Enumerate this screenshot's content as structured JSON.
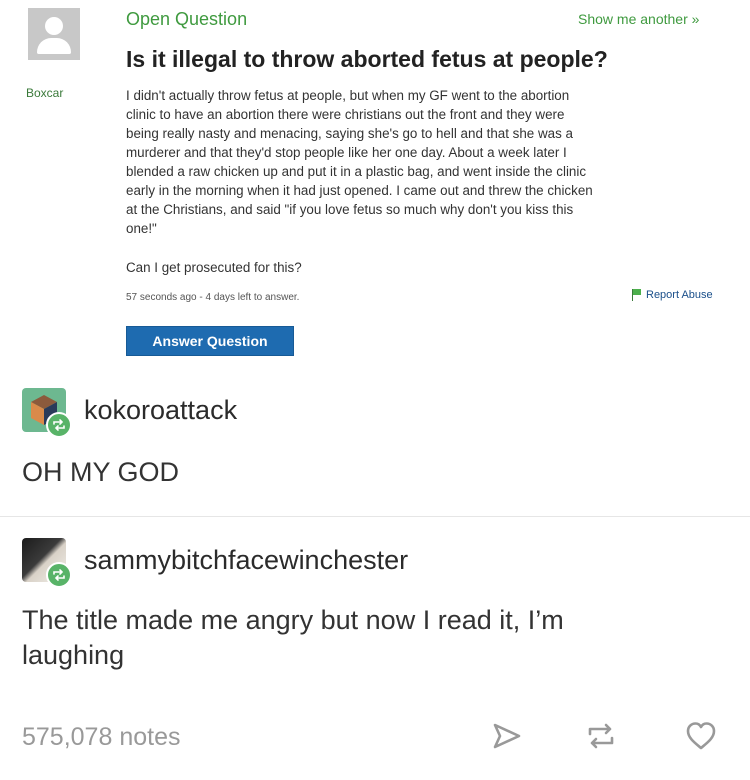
{
  "question": {
    "label": "Open Question",
    "show_another": "Show me another »",
    "asker": "Boxcar",
    "title": "Is it illegal to throw aborted fetus at people?",
    "body_lines": [
      "I didn't actually throw fetus at people, but when my GF went to the abortion",
      "clinic to have an abortion there were christians out the front and they were",
      "being really nasty and menacing, saying she's go to hell and that she was a",
      "murderer and that they'd stop people like her one day. About a week later I",
      "blended a raw chicken up and put it in a plastic bag, and went inside the clinic",
      "early in the morning when it had just opened. I came out and threw the chicken",
      "at the Christians, and said \"if you love fetus so much why don't you kiss this",
      "one!\""
    ],
    "followup": "Can I get prosecuted for this?",
    "meta": "57 seconds ago - 4 days left to answer.",
    "report": "Report Abuse",
    "answer_button": "Answer Question"
  },
  "posts": [
    {
      "username": "kokoroattack",
      "text": "OH MY GOD"
    },
    {
      "username": "sammybitchfacewinchester",
      "text_lines": [
        "The title made me angry but now I read it, I’m",
        "laughing"
      ]
    }
  ],
  "footer": {
    "notes": "575,078 notes"
  },
  "icons": {
    "reblog_badge": "reblog-icon",
    "share": "share-icon",
    "reblog": "reblog-icon",
    "like": "heart-icon"
  },
  "colors": {
    "green": "#3f9a3f",
    "button": "#1e6bb0",
    "reblog": "#58b368"
  }
}
